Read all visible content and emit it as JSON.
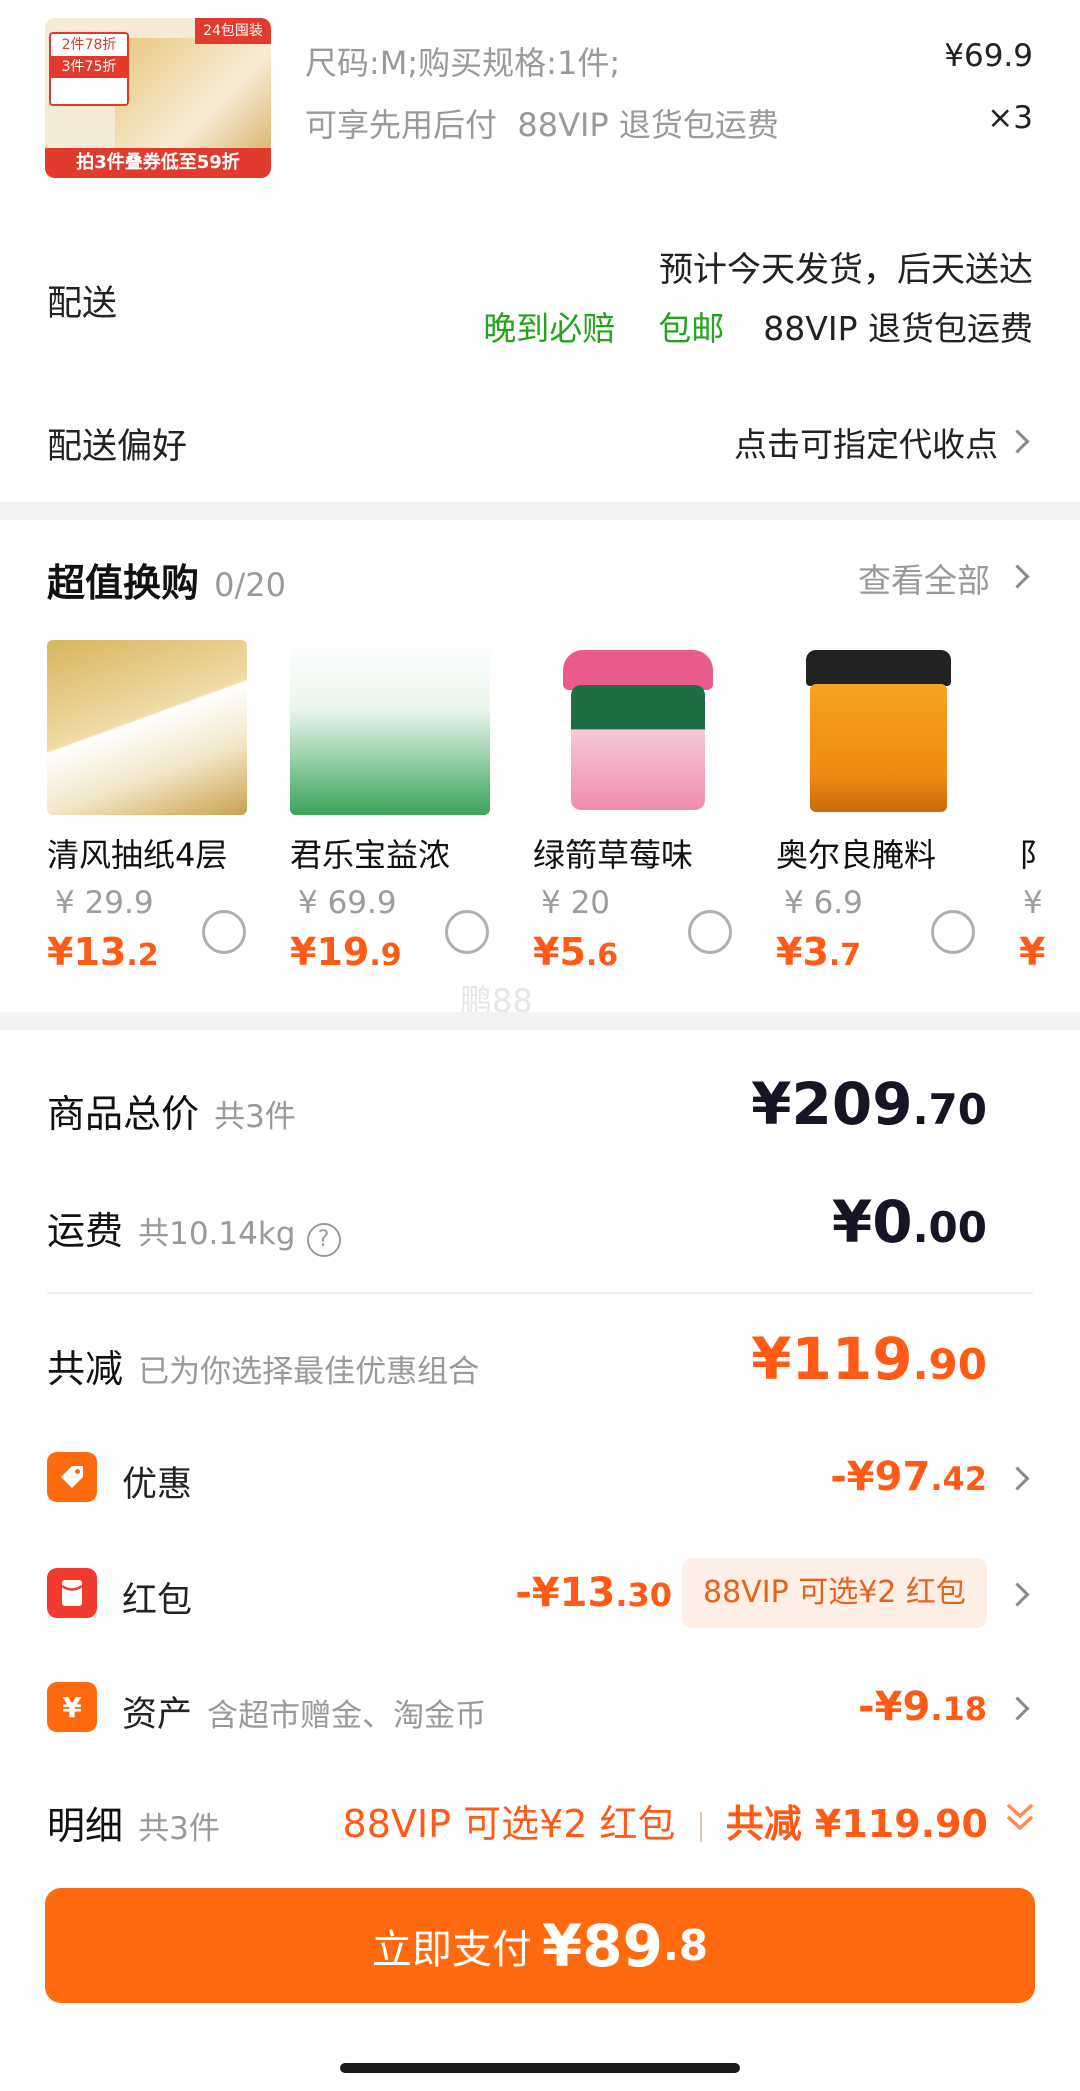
{
  "order_item": {
    "badge_top_left": "2件78折",
    "badge_second": "3件75折",
    "badge_top_right": "24包囤装",
    "badge_bottom": "拍3件叠券低至59折",
    "spec": "尺码:M;购买规格:1件;",
    "price": "¥69.9",
    "services": "可享先用后付  88VIP 退货包运费",
    "quantity": "×3"
  },
  "delivery": {
    "label": "配送",
    "eta": "预计今天发货，后天送达",
    "tag_late_pay": "晚到必赔",
    "tag_free_ship": "包邮",
    "tag_return": "88VIP 退货包运费"
  },
  "delivery_pref": {
    "label": "配送偏好",
    "value": "点击可指定代收点"
  },
  "exchange": {
    "title": "超值换购",
    "count": "0/20",
    "view_all": "查看全部",
    "products": [
      {
        "name": "清风抽纸4层",
        "old_price": "¥ 29.9",
        "new_int": "¥13",
        "new_dec": ".2"
      },
      {
        "name": "君乐宝益浓",
        "old_price": "¥ 69.9",
        "new_int": "¥19",
        "new_dec": ".9"
      },
      {
        "name": "绿箭草莓味",
        "old_price": "¥ 20",
        "new_int": "¥5",
        "new_dec": ".6"
      },
      {
        "name": "奥尔良腌料",
        "old_price": "¥ 6.9",
        "new_int": "¥3",
        "new_dec": ".7"
      },
      {
        "name": "阝",
        "old_price": "¥",
        "new_int": "¥",
        "new_dec": ""
      }
    ],
    "watermark": "鹏88"
  },
  "summary": {
    "total_label": "商品总价",
    "total_count": "共3件",
    "total_int": "¥209",
    "total_dec": ".70",
    "shipping_label": "运费",
    "shipping_weight": "共10.14kg",
    "shipping_int": "¥0",
    "shipping_dec": ".00",
    "reduce_label": "共减",
    "reduce_note": "已为你选择最佳优惠组合",
    "reduce_int": "¥119",
    "reduce_dec": ".90",
    "discount_label": "优惠",
    "discount_int": "-¥97",
    "discount_dec": ".42",
    "redpacket_label": "红包",
    "redpacket_int": "-¥13",
    "redpacket_dec": ".30",
    "redpacket_tag": "88VIP 可选¥2 红包",
    "assets_label": "资产",
    "assets_note": "含超市赠金、淘金币",
    "assets_int": "-¥9",
    "assets_dec": ".18"
  },
  "footer": {
    "detail_label": "明细",
    "detail_count": "共3件",
    "vip_note": "88VIP 可选¥2 红包",
    "reduce_text": "共减 ¥119.90",
    "pay_label": "立即支付",
    "pay_int": "¥89",
    "pay_dec": ".8"
  },
  "colors": {
    "accent": "#ff5a16",
    "green": "#22a51d",
    "button": "#ff6a0f"
  }
}
